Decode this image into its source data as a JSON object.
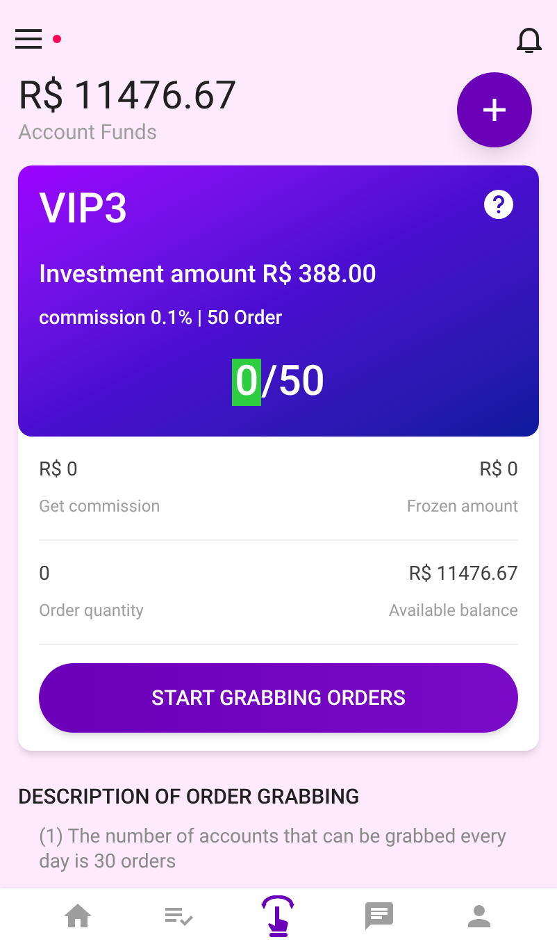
{
  "header": {
    "notification_dot": true
  },
  "balance": {
    "amount": "R$ 11476.67",
    "label": "Account Funds"
  },
  "vip_card": {
    "level": "VIP3",
    "investment": "Investment amount R$ 388.00",
    "commission": "commission 0.1% | 50 Order",
    "progress_done": "0",
    "progress_total": "/50"
  },
  "stats": [
    [
      {
        "value": "R$ 0",
        "label": "Get commission"
      },
      {
        "value": "R$ 0",
        "label": "Frozen amount"
      }
    ],
    [
      {
        "value": "0",
        "label": "Order quantity"
      },
      {
        "value": "R$ 11476.67",
        "label": "Available balance"
      }
    ]
  ],
  "grab_button": "START GRABBING ORDERS",
  "description": {
    "title": "DESCRIPTION OF ORDER GRABBING",
    "text": "(1) The number of accounts that can be grabbed every day is 30 orders"
  },
  "nav": [
    {
      "kind": "home",
      "selected": false
    },
    {
      "kind": "list",
      "selected": false
    },
    {
      "kind": "grab",
      "selected": true
    },
    {
      "kind": "chat",
      "selected": false
    },
    {
      "kind": "person",
      "selected": false
    }
  ]
}
